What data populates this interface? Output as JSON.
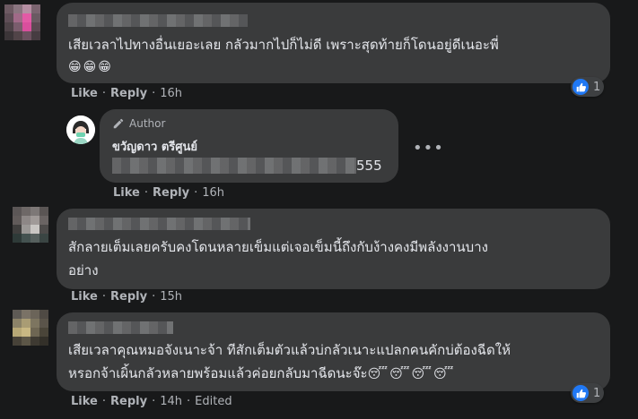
{
  "comments": [
    {
      "text_lines": [
        "เสียเวลาไปทางอื่นเยอะเลย กลัวมากไปก็ไม่ดี เพราะสุดท้ายก็โดนอยู่ดีเนอะพี่"
      ],
      "emojis": [
        "😁",
        "😁",
        "😁"
      ],
      "like_label": "Like",
      "reply_label": "Reply",
      "time": "16h",
      "reaction_count": "1",
      "avatar_colors": [
        "#6d5a63",
        "#8a7580",
        "#b58fa3",
        "#7b6470",
        "#5f4e57",
        "#a06a88",
        "#e25aa5",
        "#6a5a62",
        "#4e4348",
        "#7a5d6d",
        "#d94f9d",
        "#5b4a52",
        "#3b3538",
        "#514448",
        "#6c5260",
        "#463c41"
      ]
    },
    {
      "author_badge": "Author",
      "author_name": "ขวัญดาว ตรีศูนย์",
      "text_suffix": "555",
      "like_label": "Like",
      "reply_label": "Reply",
      "time": "16h",
      "more": "•••"
    },
    {
      "text_lines": [
        "สักลายเต็มเลยครับคงโดนหลายเข็มแต่เจอเข็มนี้ถึงกับง้างคงมีพลังงานบาง",
        "อย่าง"
      ],
      "like_label": "Like",
      "reply_label": "Reply",
      "time": "15h",
      "avatar_colors": [
        "#5b5656",
        "#6e6867",
        "#7d7877",
        "#5a5554",
        "#615b5a",
        "#8d8786",
        "#a09a98",
        "#6a6463",
        "#3f3e3d",
        "#9a9795",
        "#c9c6c3",
        "#4d4b4a",
        "#2e3a38",
        "#445250",
        "#56605e",
        "#3a4543"
      ]
    },
    {
      "text_lines": [
        "เสียเวลาคุณหมอจังเนาะจ้า ทีสักเต็มตัวแล้วบ่กลัวเนาะแปลกคนคักบ่ต้องฉีดให้",
        "หรอกจ้าเผิ้นกลัวหลายพร้อมแล้วค่อยกลับมาฉีดนะจ๊ะ"
      ],
      "emojis": [
        "😴",
        "😴",
        "😴",
        "😴"
      ],
      "like_label": "Like",
      "reply_label": "Reply",
      "time": "14h",
      "edited": "Edited",
      "reaction_count": "1",
      "avatar_colors": [
        "#5e5a55",
        "#7a7266",
        "#6b6459",
        "#4f4a44",
        "#8b8268",
        "#a99c74",
        "#7d7560",
        "#5a544a",
        "#b7a876",
        "#c9b883",
        "#6e6653",
        "#4a4539",
        "#474238",
        "#5c5647",
        "#3e3a32",
        "#333029"
      ]
    }
  ],
  "colors": {
    "background": "#18191a",
    "bubble": "#3a3b3c",
    "meta_text": "#b0b3b8",
    "like_blue": "#2078f4"
  }
}
